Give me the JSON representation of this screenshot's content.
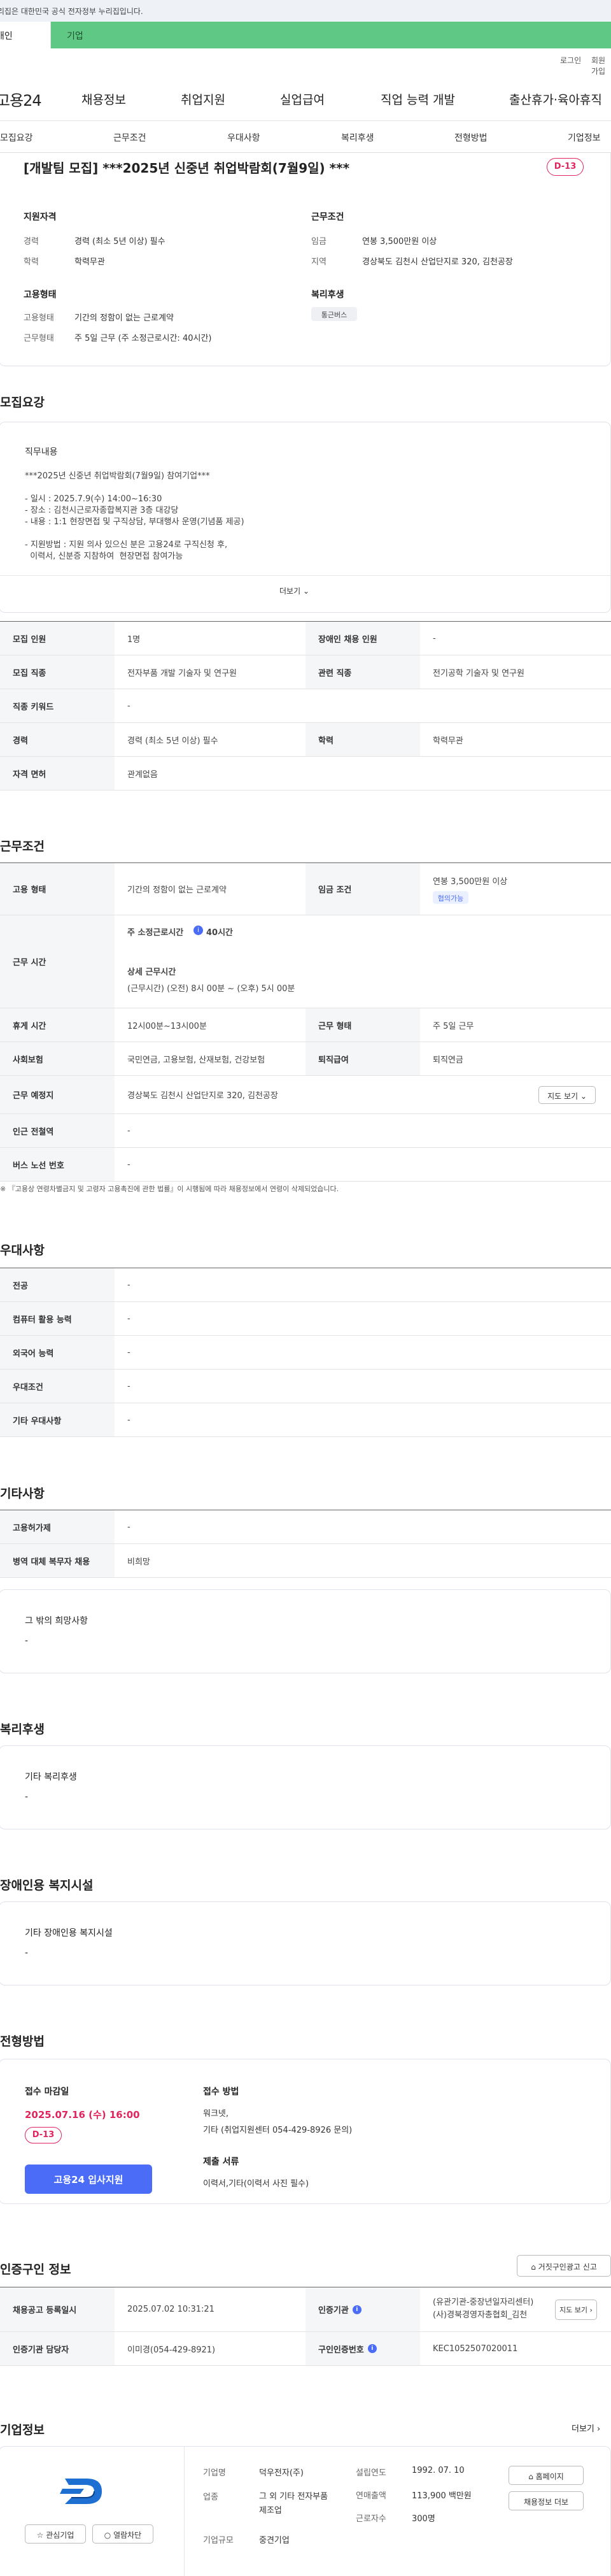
{
  "gov_banner": "이 누리집은 대한민국 공식 전자정부 누리집입니다.",
  "top_tabs": {
    "personal": "개인",
    "company": "기업"
  },
  "util": {
    "login": "로그인",
    "signup": "회원가입"
  },
  "logo": "고용24",
  "gnb": [
    "채용정보",
    "취업지원",
    "실업급여",
    "직업 능력 개발",
    "출산휴가·육아휴직"
  ],
  "snb": [
    "모집요강",
    "근무조건",
    "우대사항",
    "복리후생",
    "전형방법",
    "기업정보"
  ],
  "summary": {
    "title": "[개발팀 모집] ***2025년 신중년 취업박람회(7월9일) ***",
    "dday": "D-13",
    "qualification": {
      "heading": "지원자격",
      "rows": [
        {
          "label": "경력",
          "value": "경력 (최소 5년 이상) 필수"
        },
        {
          "label": "학력",
          "value": "학력무관"
        }
      ]
    },
    "conditions": {
      "heading": "근무조건",
      "rows": [
        {
          "label": "임금",
          "value": "연봉 3,500만원 이상"
        },
        {
          "label": "지역",
          "value": "경상북도 김천시 산업단지로 320, 김천공장"
        }
      ]
    },
    "employment": {
      "heading": "고용형태",
      "rows": [
        {
          "label": "고용형태",
          "value": "기간의 정함이 없는 근로계약"
        },
        {
          "label": "근무형태",
          "value": "주 5일 근무 (주 소정근로시간: 40시간)"
        }
      ]
    },
    "welfare": {
      "heading": "복리후생",
      "chip": "통근버스"
    }
  },
  "recruit": {
    "title": "모집요강",
    "job_heading": "직무내용",
    "job_lines": [
      "***2025년 신중년 취업박람회(7월9일) 참여기업***",
      "",
      "- 일시 : 2025.7.9(수) 14:00~16:30",
      "- 장소 : 김천시근로자종합복지관 3층 대강당",
      "- 내용 : 1:1 현장면접 및 구직상담, 부대행사 운영(기념품 제공)",
      "",
      "- 지원방법 : 지원 의사 있으신 분은 고용24로 구직신청 후,",
      "  이력서, 신분증 지참하여  현장면접 참여가능"
    ],
    "more": "더보기",
    "table": [
      {
        "th1": "모집 인원",
        "td1": "1명",
        "th2": "장애인 채용 인원",
        "td2": "-"
      },
      {
        "th1": "모집 직종",
        "td1": "전자부품 개발 기술자 및 연구원",
        "th2": "관련 직종",
        "td2": "전기공학 기술자 및 연구원"
      },
      {
        "th1": "직종 키워드",
        "td1": "-",
        "th2": "",
        "td2": ""
      },
      {
        "th1": "경력",
        "td1": "경력 (최소 5년 이상) 필수",
        "th2": "학력",
        "td2": "학력무관"
      },
      {
        "th1": "자격 면허",
        "td1": "관계없음",
        "th2": "",
        "td2": ""
      }
    ]
  },
  "work": {
    "title": "근무조건",
    "employment_type": {
      "th": "고용 형태",
      "td": "기간의 정함이 없는 근로계약",
      "th2": "임금 조건",
      "td2": "연봉 3,500만원 이상",
      "chip": "협의가능"
    },
    "hours": {
      "th": "근무 시간",
      "weekly_label": "주 소정근로시간",
      "weekly_value": "40시간",
      "detail_label": "상세 근무시간",
      "detail_value": "(근무시간) (오전) 8시 00분 ~ (오후) 5시 00분"
    },
    "rows": [
      {
        "th1": "휴게 시간",
        "td1": "12시00분~13시00분",
        "th2": "근무 형태",
        "td2": "주 5일 근무"
      },
      {
        "th1": "사회보험",
        "td1": "국민연금, 고용보험, 산재보험, 건강보험",
        "th2": "퇴직급여",
        "td2": "퇴직연금"
      }
    ],
    "location": {
      "th": "근무 예정지",
      "td": "경상북도 김천시 산업단지로 320, 김천공장",
      "map_btn": "지도 보기"
    },
    "rows2": [
      {
        "th": "인근 전철역",
        "td": "-"
      },
      {
        "th": "버스 노선 번호",
        "td": "-"
      }
    ],
    "note": "※ 『고용상 연령차별금지 및 고령자 고용촉진에 관한 법률』이 시행됨에 따라 채용정보에서 연령이 삭제되었습니다."
  },
  "pref": {
    "title": "우대사항",
    "rows": [
      {
        "th": "전공",
        "td": "-"
      },
      {
        "th": "컴퓨터 활용 능력",
        "td": "-"
      },
      {
        "th": "외국어 능력",
        "td": "-"
      },
      {
        "th": "우대조건",
        "td": "-"
      },
      {
        "th": "기타 우대사항",
        "td": "-"
      }
    ]
  },
  "etc": {
    "title": "기타사항",
    "rows": [
      {
        "th": "고용허가제",
        "td": "-"
      },
      {
        "th": "병역 대체 복무자 채용",
        "td": "비희망"
      }
    ],
    "other_heading": "그 밖의 희망사항",
    "other_value": "-"
  },
  "benefits": {
    "title": "복리후생",
    "heading": "기타 복리후생",
    "value": "-"
  },
  "disability": {
    "title": "장애인용 복지시설",
    "heading": "기타 장애인용 복지시설",
    "value": "-"
  },
  "selection": {
    "title": "전형방법",
    "deadline_heading": "접수 마감일",
    "deadline": "2025.07.16 (수) 16:00",
    "dday": "D-13",
    "apply_btn": "고용24 입사지원",
    "method_heading": "접수 방법",
    "method_lines": [
      "워크넷,",
      "기타 (취업지원센터 054-429-8926 문의)"
    ],
    "docs_heading": "제출 서류",
    "docs": "이력서,기타(이력서 사진 필수)"
  },
  "cert": {
    "title": "인증구인 정보",
    "report_btn": "거짓구인광고 신고",
    "rows": [
      {
        "th1": "채용공고 등록일시",
        "td1": "2025.07.02 10:31:21",
        "th2": "인증기관",
        "td2a": "(유관기관-중장년일자리센터)",
        "td2b": "(사)경북경영자총협회_김천",
        "btn": "지도 보기"
      },
      {
        "th1": "인증기관 담당자",
        "td1": "이미경(054-429-8921)",
        "th2": "구인인증번호",
        "td2a": "KEC1052507020011",
        "td2b": "",
        "btn": ""
      }
    ]
  },
  "company": {
    "title": "기업정보",
    "more": "더보기",
    "fav_btn": "관심기업",
    "list_btn": "열람차단",
    "info": [
      {
        "label": "기업명",
        "value": "덕우전자(주)"
      },
      {
        "label": "업종",
        "value": "그 외 기타 전자부품 제조업"
      },
      {
        "label": "기업규모",
        "value": "중견기업"
      }
    ],
    "info2": [
      {
        "label": "설립연도",
        "value": "1992. 07. 10"
      },
      {
        "label": "연매출액",
        "value": "113,900 백만원"
      },
      {
        "label": "근로자수",
        "value": "300명"
      }
    ],
    "home_btn": "홈페이지",
    "jobs_btn": "채용정보 더보"
  },
  "colors": {
    "accent": "#4a6cf7",
    "dday": "#e0245e",
    "green_tab": "#5ec884"
  }
}
